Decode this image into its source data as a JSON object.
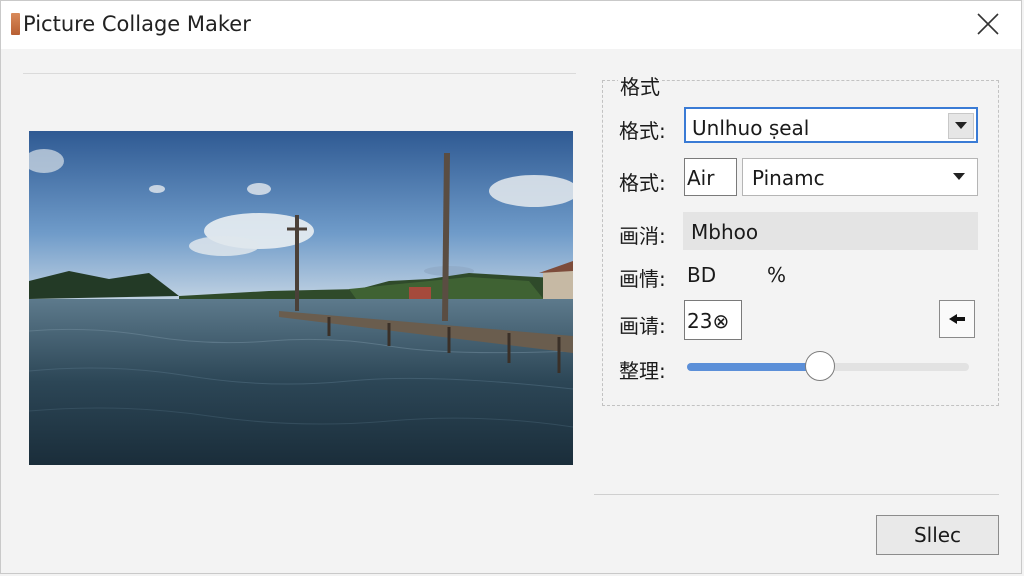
{
  "window": {
    "title": "Picture Collage Maker"
  },
  "settings": {
    "group_title": "格式",
    "format_label": "格式:",
    "format_value": "Unlhuo ṣeal",
    "format2_label": "格式:",
    "format2_field_value": "Air",
    "format2_dropdown_value": "Pinamc",
    "quality_label": "画消:",
    "quality_value": "Mbhoo",
    "ratio_label": "画情:",
    "ratio_value": "BD",
    "ratio_unit": "%",
    "size_label": "画请:",
    "size_value": "23⊗",
    "slider_label": "整理:",
    "slider_value": 0.47
  },
  "footer": {
    "select_button": "Sllec"
  },
  "icons": {
    "close": "close-icon",
    "dropdown": "chevron-down-icon",
    "spin": "arrow-left-icon"
  }
}
